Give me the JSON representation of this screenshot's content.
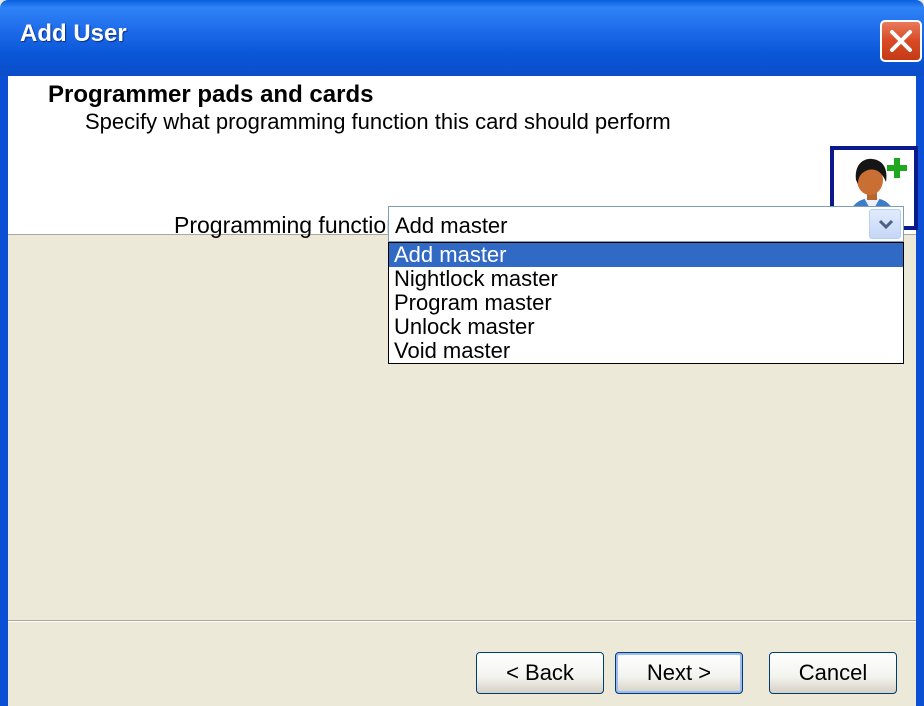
{
  "window": {
    "title": "Add User"
  },
  "header": {
    "title": "Programmer pads and cards",
    "subtitle": "Specify what programming function this card should perform"
  },
  "form": {
    "label": "Programming function:",
    "selected_value": "Add master",
    "options": [
      "Add master",
      "Nightlock master",
      "Program master",
      "Unlock master",
      "Void master"
    ],
    "highlighted_index": 0
  },
  "buttons": {
    "back": "< Back",
    "next": "Next >",
    "cancel": "Cancel"
  },
  "icons": {
    "close": "close-icon",
    "user_add": "user-add-icon",
    "dropdown": "chevron-down-icon"
  },
  "colors": {
    "titlebar": "#0A57D8",
    "selection": "#316AC5",
    "dialog_bg": "#ECE9D8",
    "close_button": "#D84A25"
  }
}
